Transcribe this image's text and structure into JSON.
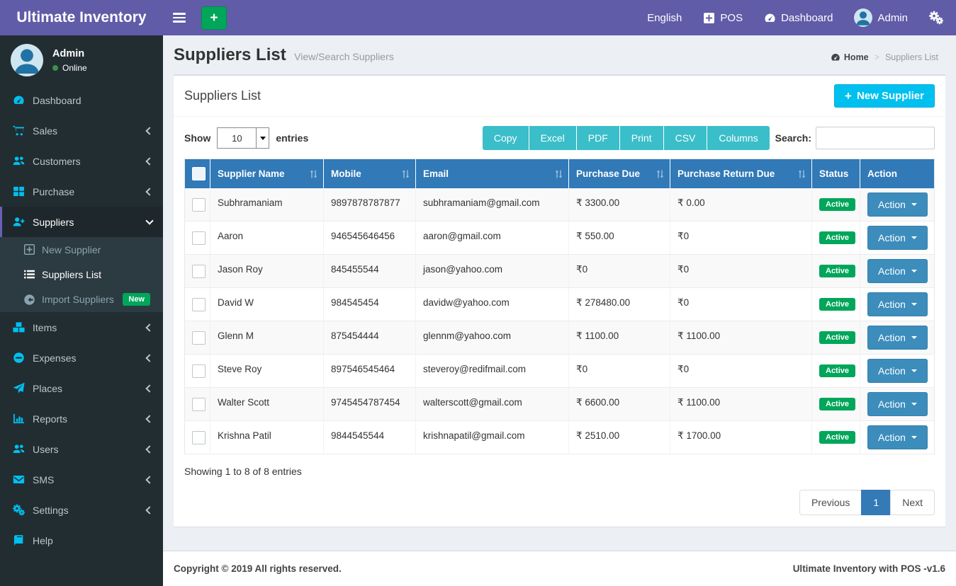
{
  "colors": {
    "topbar_purple": "#605ca8",
    "sidebar_dark": "#222d32",
    "icon_cyan": "#00c0ef",
    "table_header_blue": "#3179b7",
    "action_button_blue": "#3c8dbc",
    "export_teal": "#3abec9",
    "success_green": "#00a65a",
    "info_blue": "#00c0ef"
  },
  "topbar": {
    "brand": "Ultimate Inventory",
    "language": "English",
    "pos": "POS",
    "dashboard": "Dashboard",
    "user": "Admin"
  },
  "sidebar": {
    "user": {
      "name": "Admin",
      "status": "Online"
    },
    "items": [
      {
        "label": "Dashboard",
        "icon": "dashboard-icon",
        "chevron": ""
      },
      {
        "label": "Sales",
        "icon": "cart-icon",
        "chevron": "left"
      },
      {
        "label": "Customers",
        "icon": "users-icon",
        "chevron": "left"
      },
      {
        "label": "Purchase",
        "icon": "grid-icon",
        "chevron": "left"
      },
      {
        "label": "Suppliers",
        "icon": "user-plus-icon",
        "chevron": "down",
        "active": true,
        "submenu": [
          {
            "label": "New Supplier",
            "icon": "plus-square-outline-icon"
          },
          {
            "label": "Suppliers List",
            "icon": "list-icon",
            "active": true
          },
          {
            "label": "Import Suppliers",
            "icon": "arrow-circle-left-icon",
            "badge": "New"
          }
        ]
      },
      {
        "label": "Items",
        "icon": "cubes-icon",
        "chevron": "left"
      },
      {
        "label": "Expenses",
        "icon": "minus-circle-icon",
        "chevron": "left"
      },
      {
        "label": "Places",
        "icon": "send-icon",
        "chevron": "left"
      },
      {
        "label": "Reports",
        "icon": "chart-icon",
        "chevron": "left"
      },
      {
        "label": "Users",
        "icon": "users-icon",
        "chevron": "left"
      },
      {
        "label": "SMS",
        "icon": "envelope-icon",
        "chevron": "left"
      },
      {
        "label": "Settings",
        "icon": "gears-icon",
        "chevron": "left"
      },
      {
        "label": "Help",
        "icon": "book-icon",
        "chevron": ""
      }
    ]
  },
  "page": {
    "title": "Suppliers List",
    "subtitle": "View/Search Suppliers",
    "breadcrumb_home": "Home",
    "breadcrumb_current": "Suppliers List"
  },
  "box": {
    "title": "Suppliers List",
    "new_supplier_label": "New Supplier"
  },
  "controls": {
    "show_label": "Show",
    "page_length": "10",
    "entries_label": "entries",
    "export_buttons": [
      "Copy",
      "Excel",
      "PDF",
      "Print",
      "CSV",
      "Columns"
    ],
    "search_label": "Search:",
    "search_value": ""
  },
  "table": {
    "columns": [
      {
        "label": "",
        "sortable": false
      },
      {
        "label": "Supplier Name",
        "sortable": true
      },
      {
        "label": "Mobile",
        "sortable": true
      },
      {
        "label": "Email",
        "sortable": true
      },
      {
        "label": "Purchase Due",
        "sortable": true
      },
      {
        "label": "Purchase Return Due",
        "sortable": true
      },
      {
        "label": "Status",
        "sortable": false
      },
      {
        "label": "Action",
        "sortable": false
      }
    ],
    "rows": [
      {
        "name": "Subhramaniam",
        "mobile": "9897878787877",
        "email": "subhramaniam@gmail.com",
        "purchase_due": "₹ 3300.00",
        "purchase_return_due": "₹ 0.00",
        "status": "Active",
        "action": "Action"
      },
      {
        "name": "Aaron",
        "mobile": "946545646456",
        "email": "aaron@gmail.com",
        "purchase_due": "₹ 550.00",
        "purchase_return_due": "₹0",
        "status": "Active",
        "action": "Action"
      },
      {
        "name": "Jason Roy",
        "mobile": "845455544",
        "email": "jason@yahoo.com",
        "purchase_due": "₹0",
        "purchase_return_due": "₹0",
        "status": "Active",
        "action": "Action"
      },
      {
        "name": "David W",
        "mobile": "984545454",
        "email": "davidw@yahoo.com",
        "purchase_due": "₹ 278480.00",
        "purchase_return_due": "₹0",
        "status": "Active",
        "action": "Action"
      },
      {
        "name": "Glenn M",
        "mobile": "875454444",
        "email": "glennm@yahoo.com",
        "purchase_due": "₹ 1100.00",
        "purchase_return_due": "₹ 1100.00",
        "status": "Active",
        "action": "Action"
      },
      {
        "name": "Steve Roy",
        "mobile": "897546545464",
        "email": "steveroy@redifmail.com",
        "purchase_due": "₹0",
        "purchase_return_due": "₹0",
        "status": "Active",
        "action": "Action"
      },
      {
        "name": "Walter Scott",
        "mobile": "9745454787454",
        "email": "walterscott@gmail.com",
        "purchase_due": "₹ 6600.00",
        "purchase_return_due": "₹ 1100.00",
        "status": "Active",
        "action": "Action"
      },
      {
        "name": "Krishna Patil",
        "mobile": "9844545544",
        "email": "krishnapatil@gmail.com",
        "purchase_due": "₹ 2510.00",
        "purchase_return_due": "₹ 1700.00",
        "status": "Active",
        "action": "Action"
      }
    ],
    "summary": "Showing 1 to 8 of 8 entries"
  },
  "pagination": {
    "previous": "Previous",
    "current": "1",
    "next": "Next"
  },
  "footer": {
    "left": "Copyright © 2019 All rights reserved.",
    "right": "Ultimate Inventory with POS -v1.6"
  }
}
